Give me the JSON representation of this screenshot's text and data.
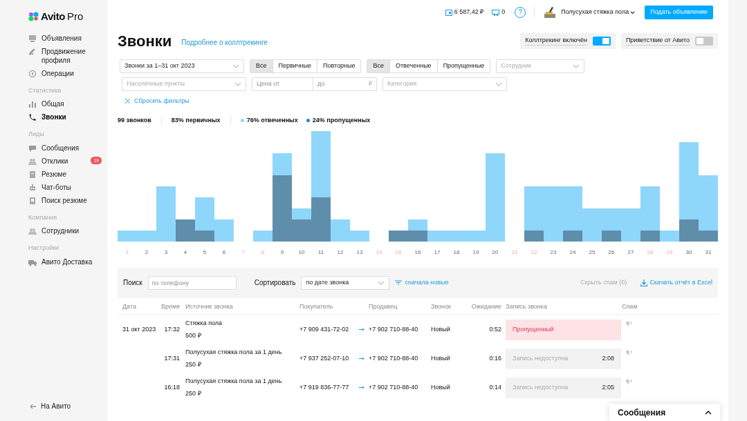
{
  "logo": {
    "name": "Avito",
    "suffix": "Pro"
  },
  "header": {
    "balance": "6 587,42 ₽",
    "bonus": "0",
    "help": "?",
    "profile": "Полусухая стяжка пола",
    "post_button": "Подать объявление"
  },
  "sidebar": {
    "sections": [
      {
        "items": [
          {
            "label": "Объявления",
            "selected": false
          },
          {
            "label": "Продвижение профиля",
            "selected": false
          },
          {
            "label": "Операции",
            "selected": false
          }
        ]
      },
      {
        "heading": "Статистика",
        "items": [
          {
            "label": "Общая",
            "selected": false
          },
          {
            "label": "Звонки",
            "selected": true
          }
        ]
      },
      {
        "heading": "Лиды",
        "items": [
          {
            "label": "Сообщения",
            "selected": false
          },
          {
            "label": "Отклики",
            "selected": false,
            "badge": "19"
          },
          {
            "label": "Резюме",
            "selected": false
          },
          {
            "label": "Чат-боты",
            "selected": false
          },
          {
            "label": "Поиск резюме",
            "selected": false
          }
        ]
      },
      {
        "heading": "Компания",
        "items": [
          {
            "label": "Сотрудники",
            "selected": false
          }
        ]
      },
      {
        "heading": "Настройки",
        "items": [
          {
            "label": "Авито Доставка",
            "selected": false
          }
        ]
      }
    ],
    "footer": "На Авито"
  },
  "page": {
    "title": "Звонки",
    "link": "Подробнее о коллтрекинге"
  },
  "toggles": [
    {
      "label": "Коллтрекинг включён",
      "on": true
    },
    {
      "label": "Приветствие от Авито",
      "on": false
    }
  ],
  "filters": {
    "period": "Звонки за 1–31 окт 2023",
    "groups": [
      [
        {
          "label": "Все",
          "selected": true
        },
        {
          "label": "Первичные",
          "selected": false
        },
        {
          "label": "Повторные",
          "selected": false
        }
      ],
      [
        {
          "label": "Все",
          "selected": true
        },
        {
          "label": "Отвеченные",
          "selected": false
        },
        {
          "label": "Пропущенные",
          "selected": false
        }
      ]
    ],
    "employee_placeholder": "Сотрудник",
    "cities_placeholder": "Населённые пункты",
    "price_from_placeholder": "Цена от",
    "price_to_placeholder": "до",
    "currency": "₽",
    "category_placeholder": "Категория",
    "reset": "Сбросить фильтры"
  },
  "summary": [
    {
      "kind": "plain",
      "text": "99 звонков"
    },
    {
      "kind": "plain",
      "text": "83% первичных"
    },
    {
      "kind": "dot",
      "text": "76% отвеченных",
      "color": "#8fd6fb"
    },
    {
      "kind": "dot",
      "text": "24% пропущенных",
      "color": "#1c8ad6"
    }
  ],
  "chart": {
    "days": [
      {
        "label": "1",
        "weekend": true
      },
      {
        "label": "2",
        "weekend": false
      },
      {
        "label": "3",
        "weekend": false
      },
      {
        "label": "4",
        "weekend": false
      },
      {
        "label": "5",
        "weekend": false
      },
      {
        "label": "6",
        "weekend": false
      },
      {
        "label": "7",
        "weekend": true
      },
      {
        "label": "8",
        "weekend": true
      },
      {
        "label": "9",
        "weekend": false
      },
      {
        "label": "10",
        "weekend": false
      },
      {
        "label": "11",
        "weekend": false
      },
      {
        "label": "12",
        "weekend": false
      },
      {
        "label": "13",
        "weekend": false
      },
      {
        "label": "14",
        "weekend": true
      },
      {
        "label": "15",
        "weekend": true
      },
      {
        "label": "16",
        "weekend": false
      },
      {
        "label": "17",
        "weekend": false
      },
      {
        "label": "18",
        "weekend": false
      },
      {
        "label": "19",
        "weekend": false
      },
      {
        "label": "20",
        "weekend": false
      },
      {
        "label": "21",
        "weekend": true
      },
      {
        "label": "22",
        "weekend": true
      },
      {
        "label": "23",
        "weekend": false
      },
      {
        "label": "24",
        "weekend": false
      },
      {
        "label": "25",
        "weekend": false
      },
      {
        "label": "26",
        "weekend": false
      },
      {
        "label": "27",
        "weekend": false
      },
      {
        "label": "28",
        "weekend": true
      },
      {
        "label": "29",
        "weekend": true
      },
      {
        "label": "30",
        "weekend": false
      },
      {
        "label": "31",
        "weekend": false
      }
    ]
  },
  "toolbar": {
    "search_label": "Поиск",
    "search_placeholder": "по телефону",
    "sort_label": "Сортировать",
    "sort_value": "по дате звонка",
    "order": "сначала новые",
    "hide_spam": "Скрыть спам (0)",
    "download": "Скачать отчёт в Excel"
  },
  "table": {
    "columns": [
      "Дата",
      "Время",
      "Источник звонка",
      "Покупатель",
      "Продавец",
      "Звонок",
      "Ожидание",
      "Запись звонка",
      "Спам"
    ],
    "rows": [
      {
        "date": "31 окт 2023",
        "time": "17:32",
        "source": "Стяжка пола",
        "price": "500 ₽",
        "buyer": "+7 909 431-72-02",
        "seller": "+7 902 710-88-40",
        "call": "Новый",
        "wait": "0:52",
        "record": {
          "kind": "missed",
          "text": "Пропущенный"
        }
      },
      {
        "time": "17:31",
        "source": "Полусухая стяжка пола за 1 день",
        "price": "250 ₽",
        "buyer": "+7 937 252-07-10",
        "seller": "+7 902 710-88-40",
        "call": "Новый",
        "wait": "0:16",
        "record": {
          "kind": "unavailable",
          "text": "Запись недоступна",
          "duration": "2:08"
        }
      },
      {
        "time": "16:18",
        "source": "Полусухая стяжка пола за 1 день",
        "price": "250 ₽",
        "buyer": "+7 919 836-77-77",
        "seller": "+7 902 710-88-40",
        "call": "Новый",
        "wait": "0:14",
        "record": {
          "kind": "unavailable",
          "text": "Запись недоступна",
          "duration": "2:05"
        }
      }
    ]
  },
  "messages_widget": {
    "title": "Сообщения"
  }
}
